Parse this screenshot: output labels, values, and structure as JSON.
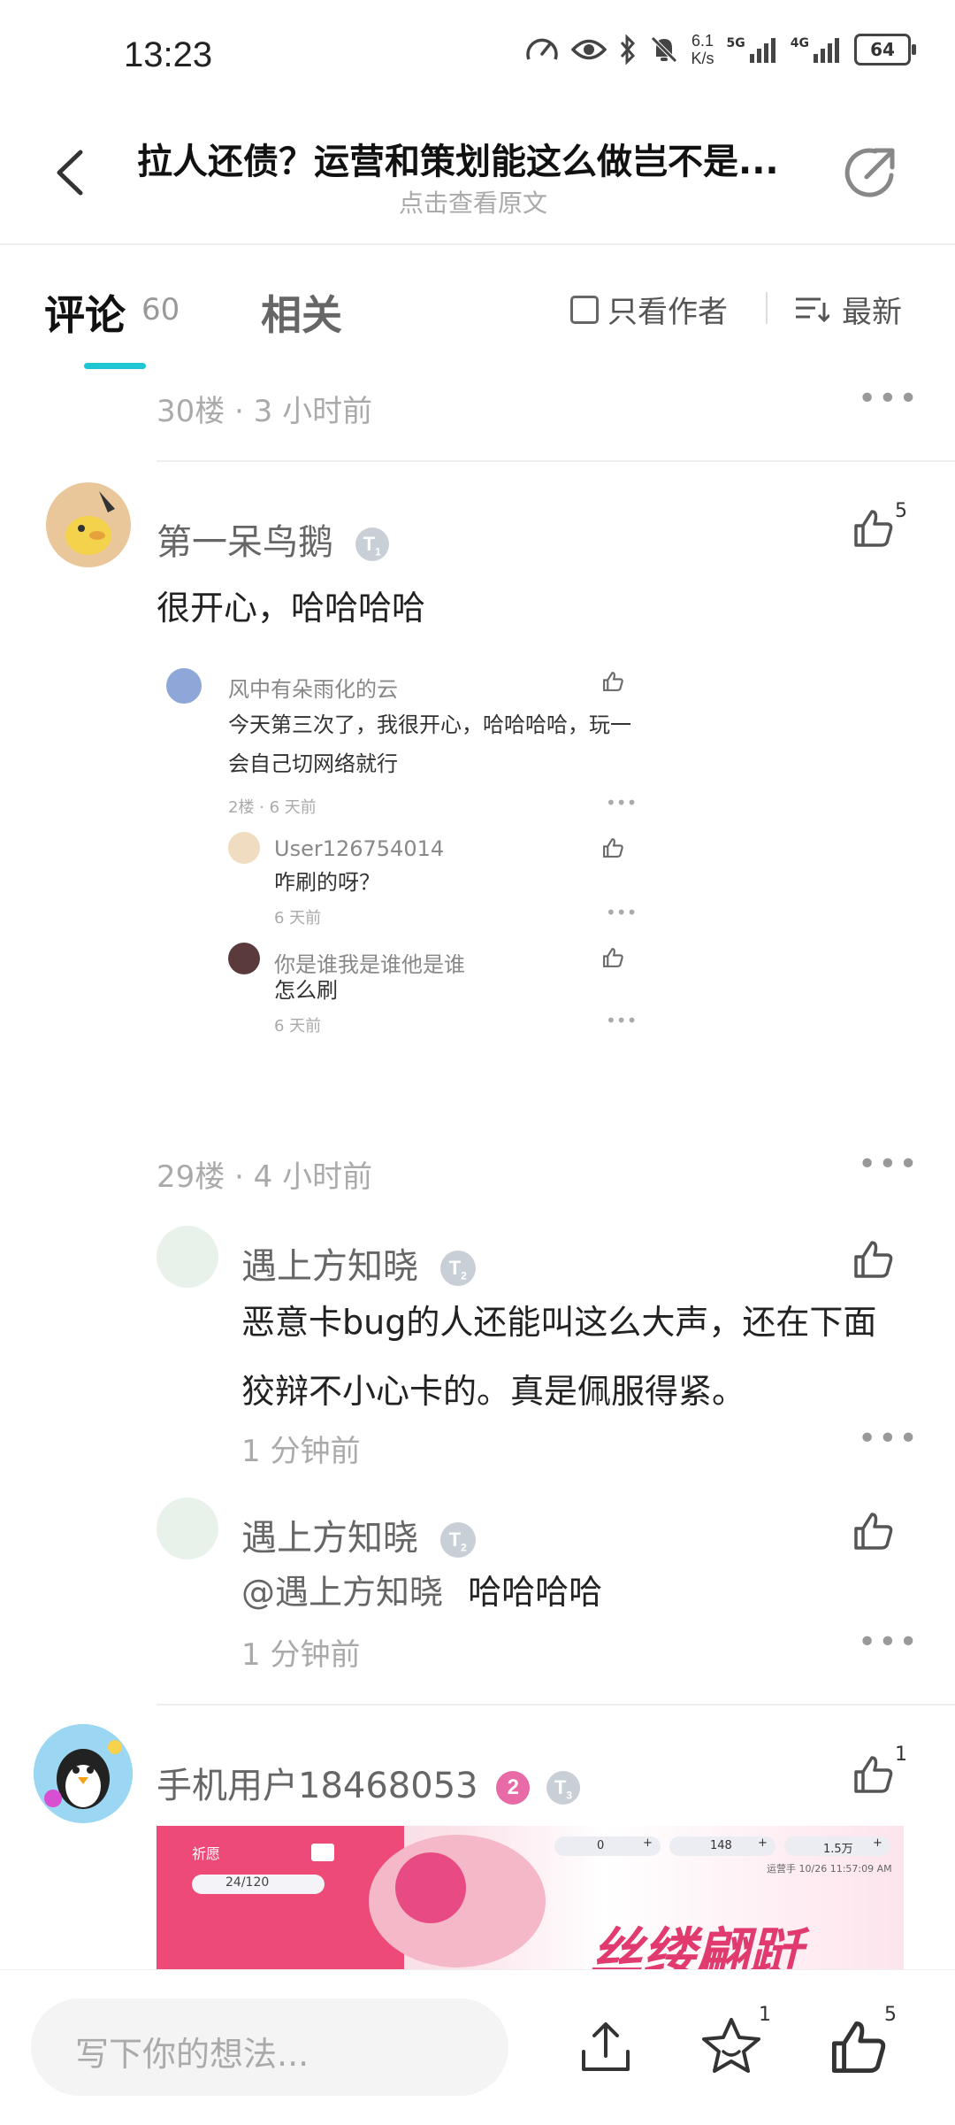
{
  "status_bar": {
    "time": "13:23",
    "net_speed_value": "6.1",
    "net_speed_unit": "K/s",
    "signal1_label": "5G",
    "signal2_label": "4G",
    "battery": "64"
  },
  "header": {
    "title": "拉人还债？运营和策划能这么做岂不是...",
    "subtitle": "点击查看原文"
  },
  "tabs": {
    "comment_label": "评论",
    "comment_count": "60",
    "related_label": "相关",
    "only_author_label": "只看作者",
    "sort_label": "最新"
  },
  "floor30": {
    "meta": "30楼 · 3 小时前",
    "author": "第一呆鸟鹅",
    "badge": "T",
    "badge_level": "1",
    "like_count": "5",
    "text": "很开心，哈哈哈哈",
    "nested": {
      "author": "风中有朵雨化的云",
      "text": "今天第三次了，我很开心，哈哈哈哈，玩一会自己切网络就行",
      "meta": "2楼 · 6 天前",
      "replies": [
        {
          "author": "User126754014",
          "text": "咋刷的呀？",
          "time": "6 天前"
        },
        {
          "author": "你是谁我是谁他是谁",
          "text": "怎么刷",
          "time": "6 天前"
        }
      ]
    }
  },
  "floor29": {
    "meta": "29楼 · 4 小时前",
    "replies": [
      {
        "author": "遇上方知晓",
        "badge": "T",
        "badge_level": "2",
        "text": "恶意卡bug的人还能叫这么大声，还在下面狡辩不小心卡的。真是佩服得紧。",
        "time": "1 分钟前"
      },
      {
        "author": "遇上方知晓",
        "badge": "T",
        "badge_level": "2",
        "mention": "@遇上方知晓",
        "text": "哈哈哈哈",
        "time": "1 分钟前"
      }
    ]
  },
  "floor28": {
    "author": "手机用户18468053",
    "badge_num": "2",
    "badge": "T",
    "badge_level": "3",
    "like_count": "1",
    "image": {
      "top_left_label": "祈愿",
      "progress": "24/120",
      "res1": "0",
      "res2": "148",
      "res3": "1.5万",
      "timestamp": "运营手 10/26 11:57:09 AM",
      "banner_text": "丝缕翩跹"
    }
  },
  "bottom_bar": {
    "placeholder": "写下你的想法...",
    "favorite_count": "1",
    "like_count": "5"
  },
  "colors": {
    "accent": "#1ec6d4",
    "badge_gray": "#c9cfd6",
    "badge_pink": "#e86aa6"
  }
}
